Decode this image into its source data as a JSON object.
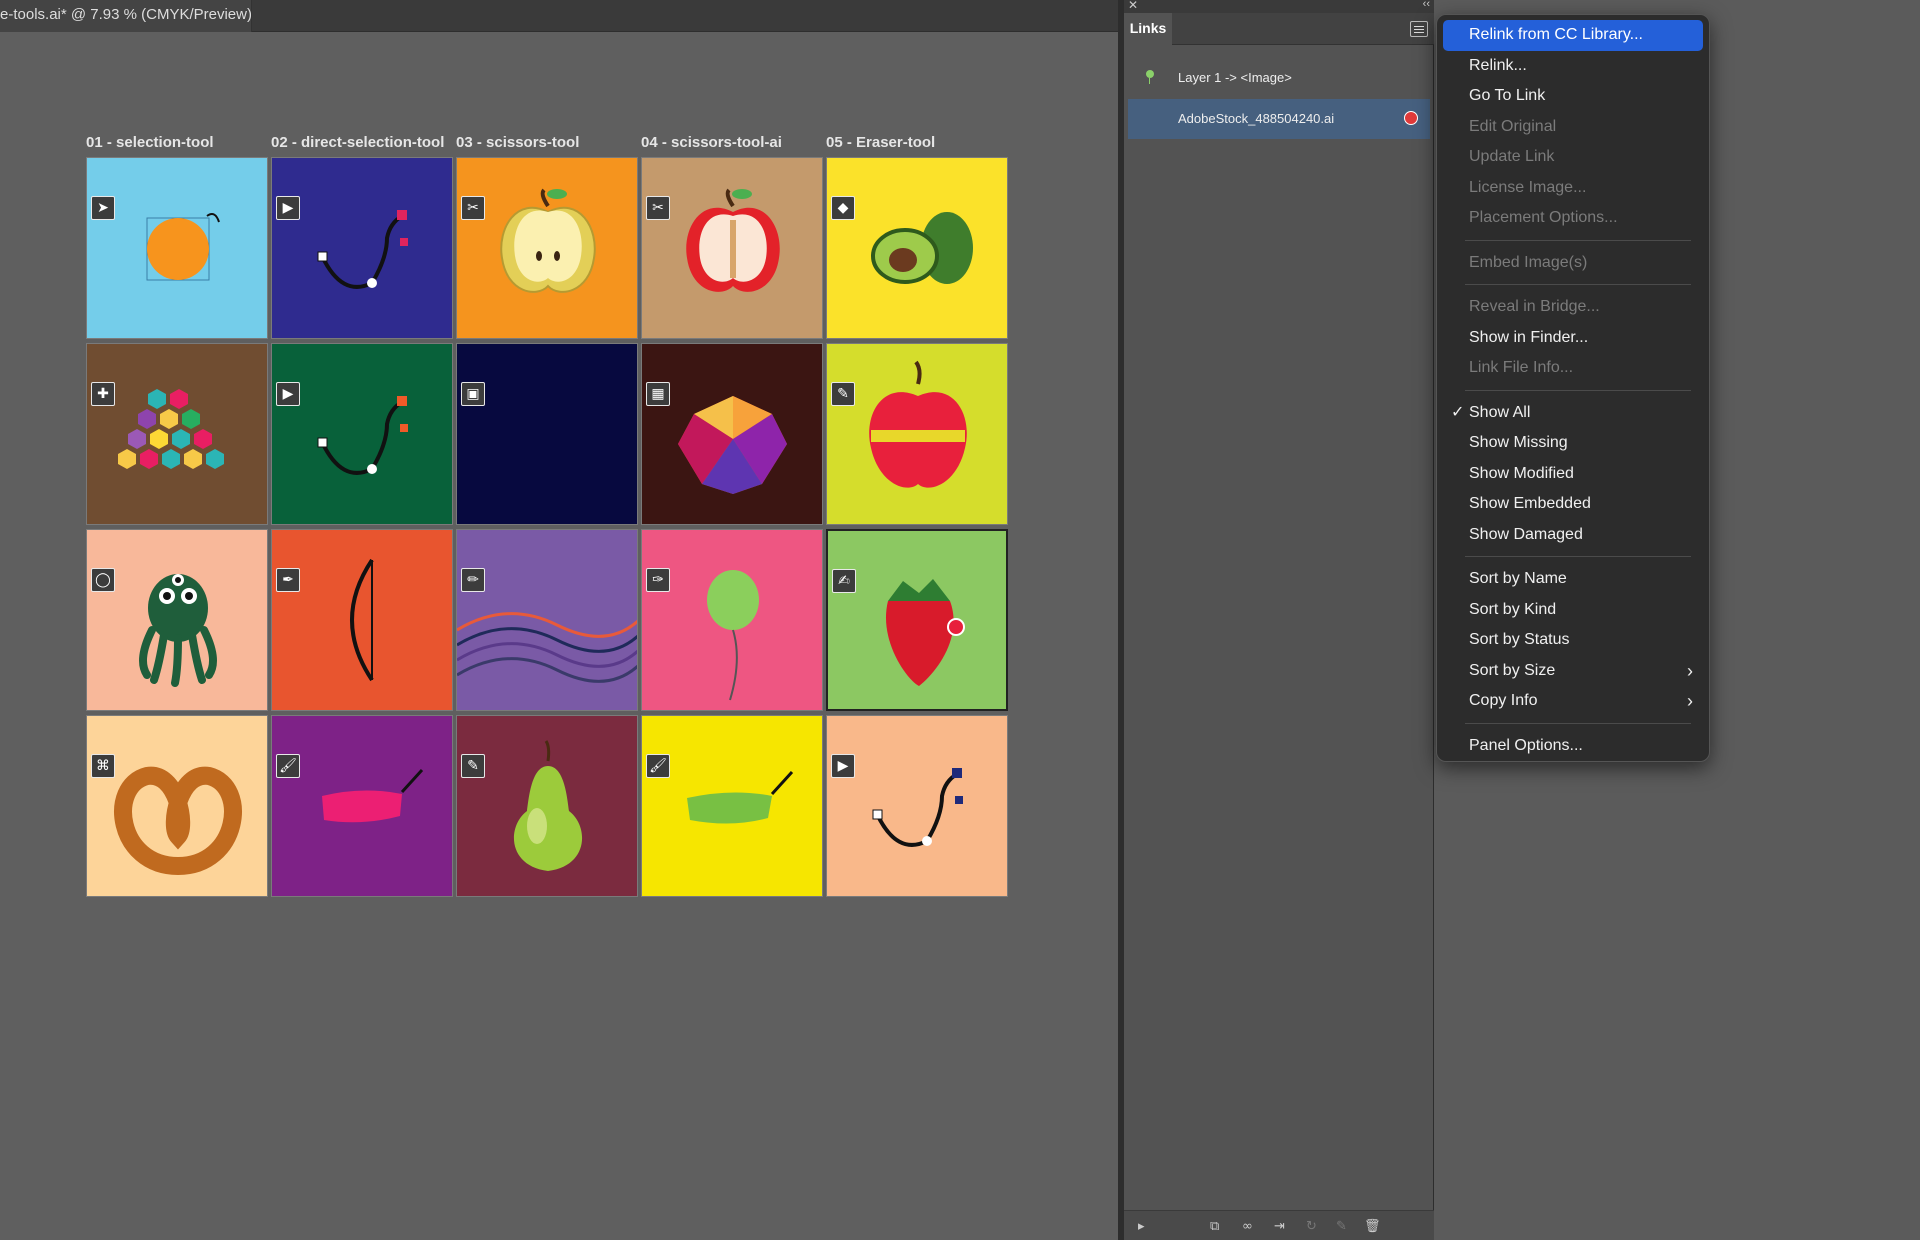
{
  "document": {
    "tab_title": "e-tools.ai* @ 7.93 % (CMYK/Preview)"
  },
  "columns": [
    "01 - selection-tool",
    "02 - direct-selection-tool",
    "03 - scissors-tool",
    "04 - scissors-tool-ai",
    "05 - Eraser-tool"
  ],
  "colors": {
    "accent": "#2460d9",
    "canvas": "#5f5f5f",
    "panel": "#535353",
    "menu": "#2c2c2c"
  },
  "tiles": [
    {
      "bg": "#74cdea",
      "icon": "selection-arrow-icon",
      "art": "orange-circle"
    },
    {
      "bg": "#2f2b8f",
      "icon": "direct-selection-icon",
      "art": "bezier-path"
    },
    {
      "bg": "#f5941e",
      "icon": "scissors-icon",
      "art": "apple-half-yellow"
    },
    {
      "bg": "#c49a6c",
      "icon": "scissors-icon",
      "art": "apple-half-red"
    },
    {
      "bg": "#fbe22a",
      "icon": "eraser-icon",
      "art": "avocado"
    },
    {
      "bg": "#704d31",
      "icon": "group-selection-icon",
      "art": "hexagons"
    },
    {
      "bg": "#08613a",
      "icon": "direct-selection-icon",
      "art": "bezier-path-green"
    },
    {
      "bg": "#07093f",
      "icon": "gradient-icon",
      "art": "empty"
    },
    {
      "bg": "#3b1512",
      "icon": "mesh-icon",
      "art": "lowpoly-gem"
    },
    {
      "bg": "#d5dd2c",
      "icon": "eyedropper-icon",
      "art": "red-apple"
    },
    {
      "bg": "#f8b89a",
      "icon": "lasso-icon",
      "art": "green-octopus"
    },
    {
      "bg": "#e8552f",
      "icon": "pen-icon",
      "art": "bow"
    },
    {
      "bg": "#7a5aa6",
      "icon": "pencil-icon",
      "art": "wavy-lines"
    },
    {
      "bg": "#ee5682",
      "icon": "curvature-icon",
      "art": "balloon"
    },
    {
      "bg": "#8cc862",
      "icon": "blob-brush-icon",
      "art": "strawberry"
    },
    {
      "bg": "#fdd499",
      "icon": "shaper-icon",
      "art": "pretzel"
    },
    {
      "bg": "#7e2287",
      "icon": "paintbrush-icon",
      "art": "pink-stroke"
    },
    {
      "bg": "#7b2b3f",
      "icon": "eyedropper-icon",
      "art": "pear"
    },
    {
      "bg": "#f6e600",
      "icon": "paintbrush-icon",
      "art": "green-stroke"
    },
    {
      "bg": "#f9b88a",
      "icon": "direct-selection-icon",
      "art": "bezier-path-navy"
    }
  ],
  "links_panel": {
    "tab_label": "Links",
    "rows": [
      {
        "label": "Layer 1 -> <Image>"
      },
      {
        "label": "AdobeStock_488504240.ai"
      }
    ]
  },
  "menu": {
    "items": [
      {
        "label": "Relink from CC Library...",
        "state": "active"
      },
      {
        "label": "Relink...",
        "state": "enabled"
      },
      {
        "label": "Go To Link",
        "state": "enabled"
      },
      {
        "label": "Edit Original",
        "state": "disabled"
      },
      {
        "label": "Update Link",
        "state": "disabled"
      },
      {
        "label": "License Image...",
        "state": "disabled"
      },
      {
        "label": "Placement Options...",
        "state": "disabled"
      },
      {
        "sep": true
      },
      {
        "label": "Embed Image(s)",
        "state": "disabled"
      },
      {
        "sep": true
      },
      {
        "label": "Reveal in Bridge...",
        "state": "disabled"
      },
      {
        "label": "Show in Finder...",
        "state": "enabled"
      },
      {
        "label": "Link File Info...",
        "state": "disabled"
      },
      {
        "sep": true
      },
      {
        "label": "Show All",
        "state": "enabled",
        "checked": true
      },
      {
        "label": "Show Missing",
        "state": "enabled"
      },
      {
        "label": "Show Modified",
        "state": "enabled"
      },
      {
        "label": "Show Embedded",
        "state": "enabled"
      },
      {
        "label": "Show Damaged",
        "state": "enabled"
      },
      {
        "sep": true
      },
      {
        "label": "Sort by Name",
        "state": "enabled"
      },
      {
        "label": "Sort by Kind",
        "state": "enabled"
      },
      {
        "label": "Sort by Status",
        "state": "enabled"
      },
      {
        "label": "Sort by Size",
        "state": "enabled",
        "submenu": true
      },
      {
        "label": "Copy Info",
        "state": "enabled",
        "submenu": true
      },
      {
        "sep": true
      },
      {
        "label": "Panel Options...",
        "state": "enabled"
      }
    ]
  }
}
